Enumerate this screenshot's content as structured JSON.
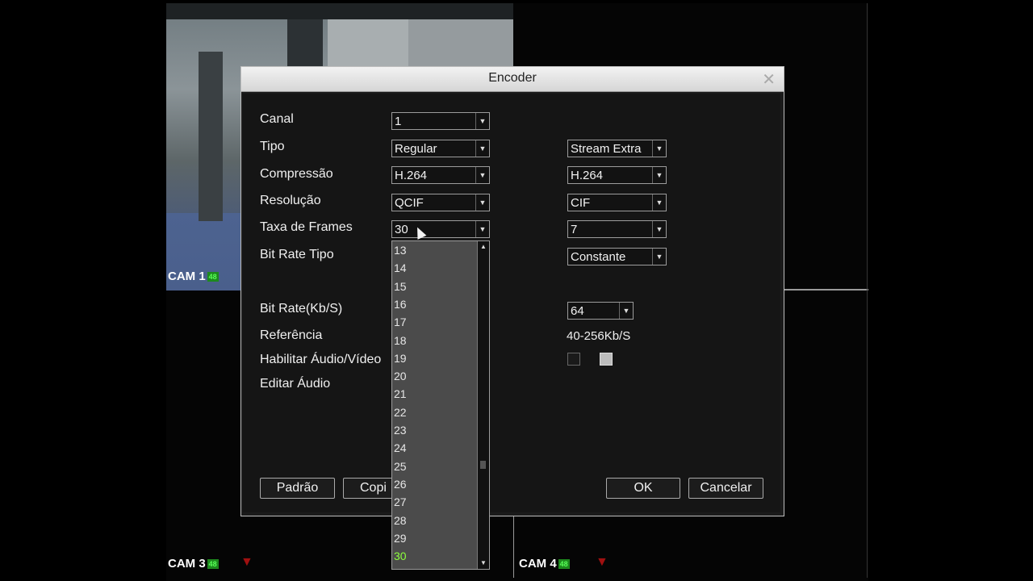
{
  "dialog": {
    "title": "Encoder",
    "close_icon": "close-icon"
  },
  "labels": {
    "canal": "Canal",
    "tipo": "Tipo",
    "compressao": "Compressão",
    "resolucao": "Resolução",
    "taxa_frames": "Taxa de Frames",
    "bit_rate_tipo": "Bit Rate Tipo",
    "bit_rate": "Bit Rate(Kb/S)",
    "referencia": "Referência",
    "habilitar": "Habilitar Áudio/Vídeo",
    "editar_audio": "Editar Áudio"
  },
  "main": {
    "canal": "1",
    "tipo": "Regular",
    "compressao": "H.264",
    "resolucao": "QCIF",
    "taxa_frames": "30"
  },
  "extra": {
    "tipo": "Stream Extra",
    "compressao": "H.264",
    "resolucao": "CIF",
    "taxa_frames": "7",
    "bit_rate_tipo": "Constante",
    "bit_rate": "64",
    "referencia": "40-256Kb/S",
    "video_enabled": false,
    "audio_enabled": true
  },
  "frame_rate_options": [
    "13",
    "14",
    "15",
    "16",
    "17",
    "18",
    "19",
    "20",
    "21",
    "22",
    "23",
    "24",
    "25",
    "26",
    "27",
    "28",
    "29",
    "30"
  ],
  "frame_rate_selected": "30",
  "buttons": {
    "padrao": "Padrão",
    "copiar": "Copi",
    "ok": "OK",
    "cancelar": "Cancelar"
  },
  "cameras": {
    "cam1": {
      "label": "CAM 1",
      "badge": "48"
    },
    "cam3": {
      "label": "CAM 3",
      "badge": "48"
    },
    "cam4": {
      "label": "CAM 4",
      "badge": "48"
    }
  }
}
